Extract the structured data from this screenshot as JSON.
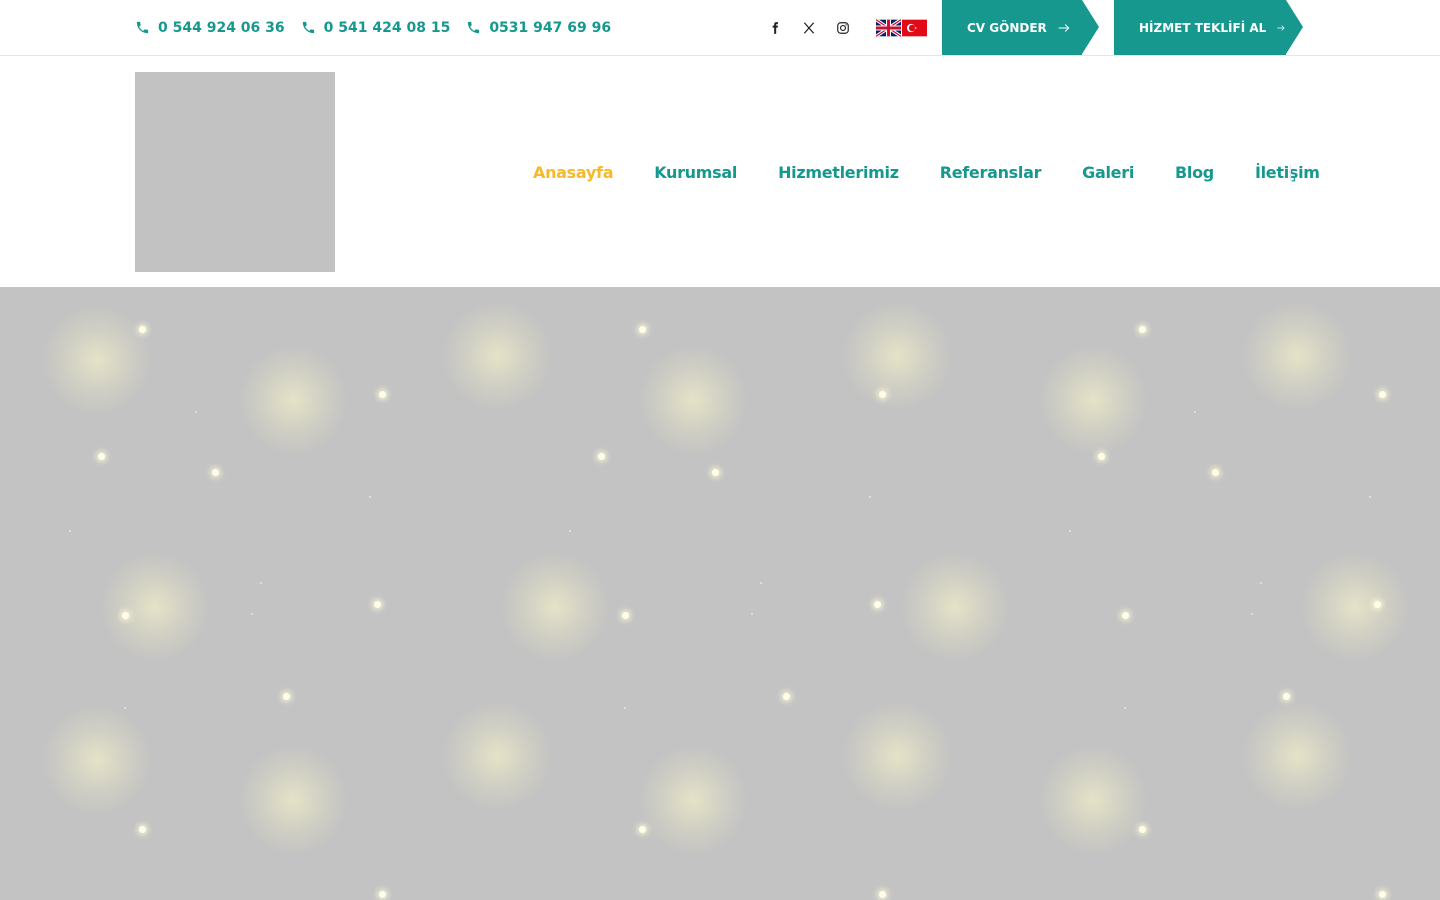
{
  "topbar": {
    "phones": [
      "0 544 924 06 36",
      "0 541 424 08 15",
      "0531 947 69 96"
    ],
    "socials": [
      "facebook-icon",
      "x-twitter-icon",
      "instagram-icon"
    ],
    "languages": [
      "English",
      "Türkçe"
    ],
    "cv_button": "CV GÖNDER",
    "quote_button": "HİZMET TEKLİFİ AL"
  },
  "nav": {
    "items": [
      "Anasayfa",
      "Kurumsal",
      "Hizmetlerimiz",
      "Referanslar",
      "Galeri",
      "Blog",
      "İletişim"
    ],
    "active": "Anasayfa"
  },
  "colors": {
    "primary": "#17988f",
    "active": "#f6b92b",
    "hero_bg": "#c3c3c3",
    "logo_placeholder": "#c2c2c2"
  }
}
